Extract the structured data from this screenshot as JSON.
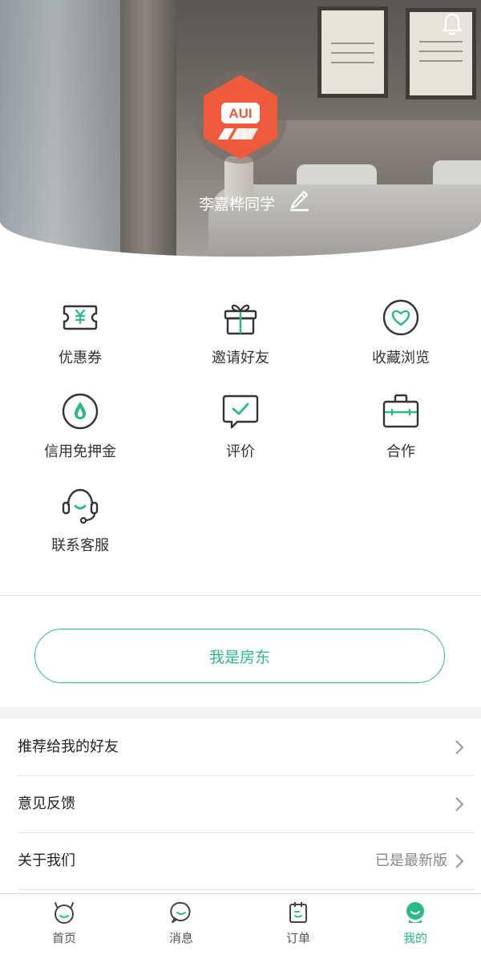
{
  "profile": {
    "username": "李嘉桦同学",
    "logo_text": "AUI"
  },
  "shortcuts": [
    {
      "label": "优惠券",
      "icon": "coupon-icon"
    },
    {
      "label": "邀请好友",
      "icon": "gift-icon"
    },
    {
      "label": "收藏浏览",
      "icon": "heart-icon"
    },
    {
      "label": "信用免押金",
      "icon": "credit-drop-icon"
    },
    {
      "label": "评价",
      "icon": "review-check-icon"
    },
    {
      "label": "合作",
      "icon": "briefcase-icon"
    },
    {
      "label": "联系客服",
      "icon": "headset-icon"
    }
  ],
  "landlord_button": "我是房东",
  "menu": [
    {
      "label": "推荐给我的好友",
      "value": ""
    },
    {
      "label": "意见反馈",
      "value": ""
    },
    {
      "label": "关于我们",
      "value": "已是最新版"
    }
  ],
  "tabs": [
    {
      "label": "首页",
      "icon": "home-face-icon",
      "active": false
    },
    {
      "label": "消息",
      "icon": "message-icon",
      "active": false
    },
    {
      "label": "订单",
      "icon": "order-icon",
      "active": false
    },
    {
      "label": "我的",
      "icon": "user-icon",
      "active": true
    }
  ],
  "colors": {
    "accent": "#2bb98a",
    "logo": "#ee5a3c",
    "icon_dark": "#333333"
  }
}
